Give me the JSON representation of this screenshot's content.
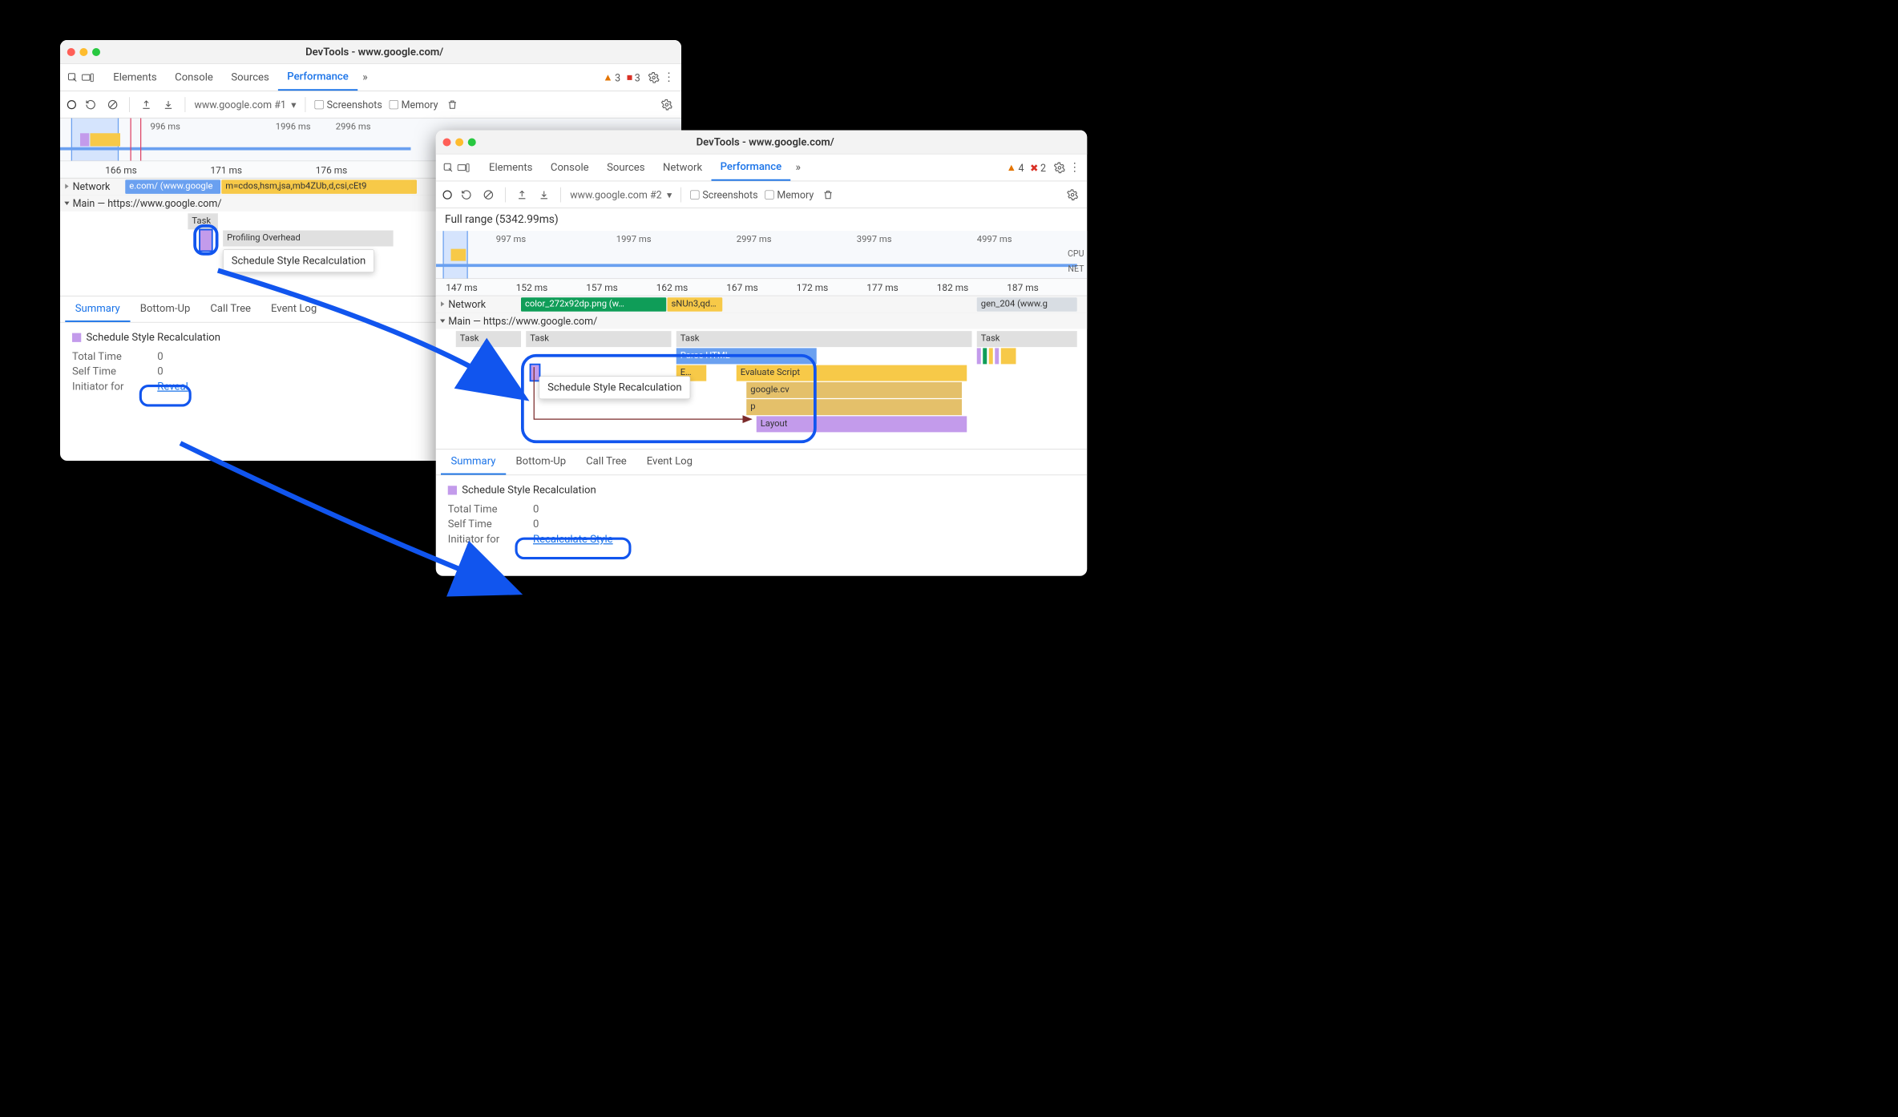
{
  "window1": {
    "title": "DevTools - www.google.com/",
    "tabs": {
      "elements": "Elements",
      "console": "Console",
      "sources": "Sources",
      "performance": "Performance"
    },
    "warn_count": "3",
    "err_count": "3",
    "profile_name": "www.google.com #1",
    "chk_screenshots": "Screenshots",
    "chk_memory": "Memory",
    "overview_ticks": [
      "996 ms",
      "1996 ms",
      "2996 ms"
    ],
    "ruler_ticks": [
      "166 ms",
      "171 ms",
      "176 ms"
    ],
    "network_label": "Network",
    "network_chips": [
      "e.com/ (www.google",
      "m=cdos,hsm,jsa,mb4ZUb,d,csi,cEt9"
    ],
    "main_label": "Main — https://www.google.com/",
    "flame": {
      "task": "Task",
      "prof": "Profiling Overhead",
      "sched": "Schedule Style Recalculation"
    },
    "detail_tabs": {
      "summary": "Summary",
      "bottomup": "Bottom-Up",
      "calltree": "Call Tree",
      "eventlog": "Event Log"
    },
    "event_title": "Schedule Style Recalculation",
    "tt": "Total Time",
    "tt_v": "0",
    "st": "Self Time",
    "st_v": "0",
    "init": "Initiator for",
    "reveal": "Reveal"
  },
  "window2": {
    "title": "DevTools - www.google.com/",
    "tabs": {
      "elements": "Elements",
      "console": "Console",
      "sources": "Sources",
      "network": "Network",
      "performance": "Performance"
    },
    "warn_count": "4",
    "err_count": "2",
    "profile_name": "www.google.com #2",
    "chk_screenshots": "Screenshots",
    "chk_memory": "Memory",
    "fullrange": "Full range (5342.99ms)",
    "overview_ticks": [
      "997 ms",
      "1997 ms",
      "2997 ms",
      "3997 ms",
      "4997 ms"
    ],
    "cpu": "CPU",
    "net": "NET",
    "ruler_ticks": [
      "147 ms",
      "152 ms",
      "157 ms",
      "162 ms",
      "167 ms",
      "172 ms",
      "177 ms",
      "182 ms",
      "187 ms"
    ],
    "network_label": "Network",
    "network_chips": [
      "color_272x92dp.png (w…",
      "sNUn3,qd…",
      "gen_204 (www.g"
    ],
    "main_label": "Main — https://www.google.com/",
    "flame": {
      "task": "Task",
      "parse": "Parse HTML",
      "eval": "Evaluate Script",
      "e": "E…",
      "googlecv": "google.cv",
      "p": "p",
      "layout": "Layout",
      "tooltip": "Schedule Style Recalculation"
    },
    "detail_tabs": {
      "summary": "Summary",
      "bottomup": "Bottom-Up",
      "calltree": "Call Tree",
      "eventlog": "Event Log"
    },
    "event_title": "Schedule Style Recalculation",
    "tt": "Total Time",
    "tt_v": "0",
    "st": "Self Time",
    "st_v": "0",
    "init": "Initiator for",
    "recalc": "Recalculate Style"
  }
}
